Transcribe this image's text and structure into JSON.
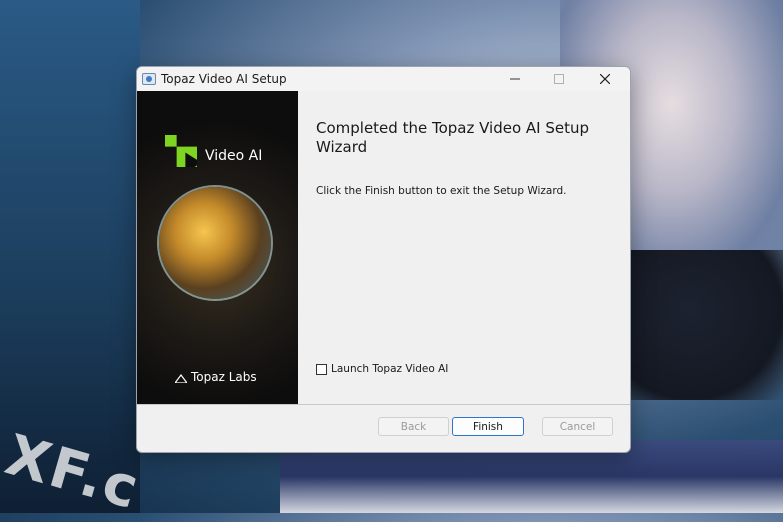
{
  "window": {
    "title": "Topaz Video AI Setup",
    "controls": [
      "minimize-icon",
      "maximize-icon",
      "close-icon"
    ]
  },
  "sidebar": {
    "product_name": "Video AI",
    "brand": "Topaz Labs"
  },
  "content": {
    "heading": "Completed the Topaz Video AI Setup Wizard",
    "description": "Click the Finish button to exit the Setup Wizard.",
    "launch_checkbox": {
      "label": "Launch Topaz Video AI",
      "checked": false
    }
  },
  "buttons": {
    "back": "Back",
    "finish": "Finish",
    "cancel": "Cancel"
  },
  "colors": {
    "accent": "#2d74d0",
    "logo_green": "#7fd321"
  }
}
